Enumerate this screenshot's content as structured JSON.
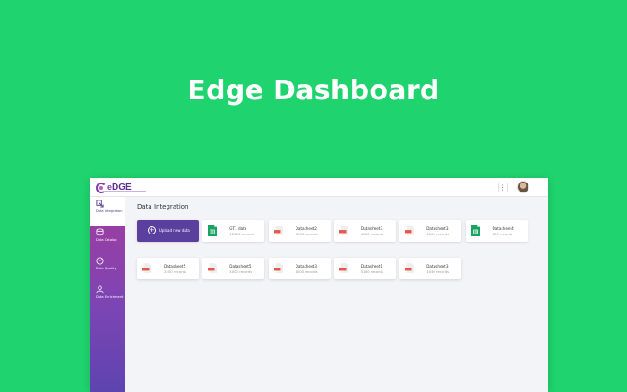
{
  "hero": {
    "title": "Edge Dashboard"
  },
  "app": {
    "logo_prefix": "e",
    "logo_text": "DGE",
    "kebab_label": "⋮"
  },
  "sidebar": {
    "items": [
      {
        "label": "Data Integration",
        "icon": "data-integration-icon",
        "active": true
      },
      {
        "label": "Data Catalog",
        "icon": "catalog-icon",
        "active": false
      },
      {
        "label": "Data Quality",
        "icon": "quality-gauge-icon",
        "active": false
      },
      {
        "label": "Data Enrichment",
        "icon": "enrichment-icon",
        "active": false
      }
    ]
  },
  "main": {
    "title": "Data Integration",
    "upload_label": "Upload new data",
    "cards": [
      {
        "name": "GT1 data",
        "records": "12500 records",
        "type": "sheet"
      },
      {
        "name": "Datasheet2",
        "records": "3200 records",
        "type": "csv"
      },
      {
        "name": "Datasheet3",
        "records": "4000 records",
        "type": "csv"
      },
      {
        "name": "Datasheet3",
        "records": "4000 records",
        "type": "csv"
      },
      {
        "name": "Datasheet4",
        "records": "100 records",
        "type": "sheet"
      },
      {
        "name": "Datasheet5",
        "records": "2500 records",
        "type": "csv"
      },
      {
        "name": "Datasheet5",
        "records": "4000 records",
        "type": "csv"
      },
      {
        "name": "Datasheet3",
        "records": "4000 records",
        "type": "csv"
      },
      {
        "name": "Datasheet1",
        "records": "5100 records",
        "type": "csv"
      },
      {
        "name": "Datasheet3",
        "records": "1040 records",
        "type": "csv"
      }
    ]
  },
  "colors": {
    "background": "#1fd46e",
    "sidebar_top": "#a43c9e",
    "sidebar_bottom": "#5e44b0",
    "upload_button": "#5b3f9e",
    "sheet_icon": "#1aa260",
    "csv_icon": "#e8554b"
  }
}
